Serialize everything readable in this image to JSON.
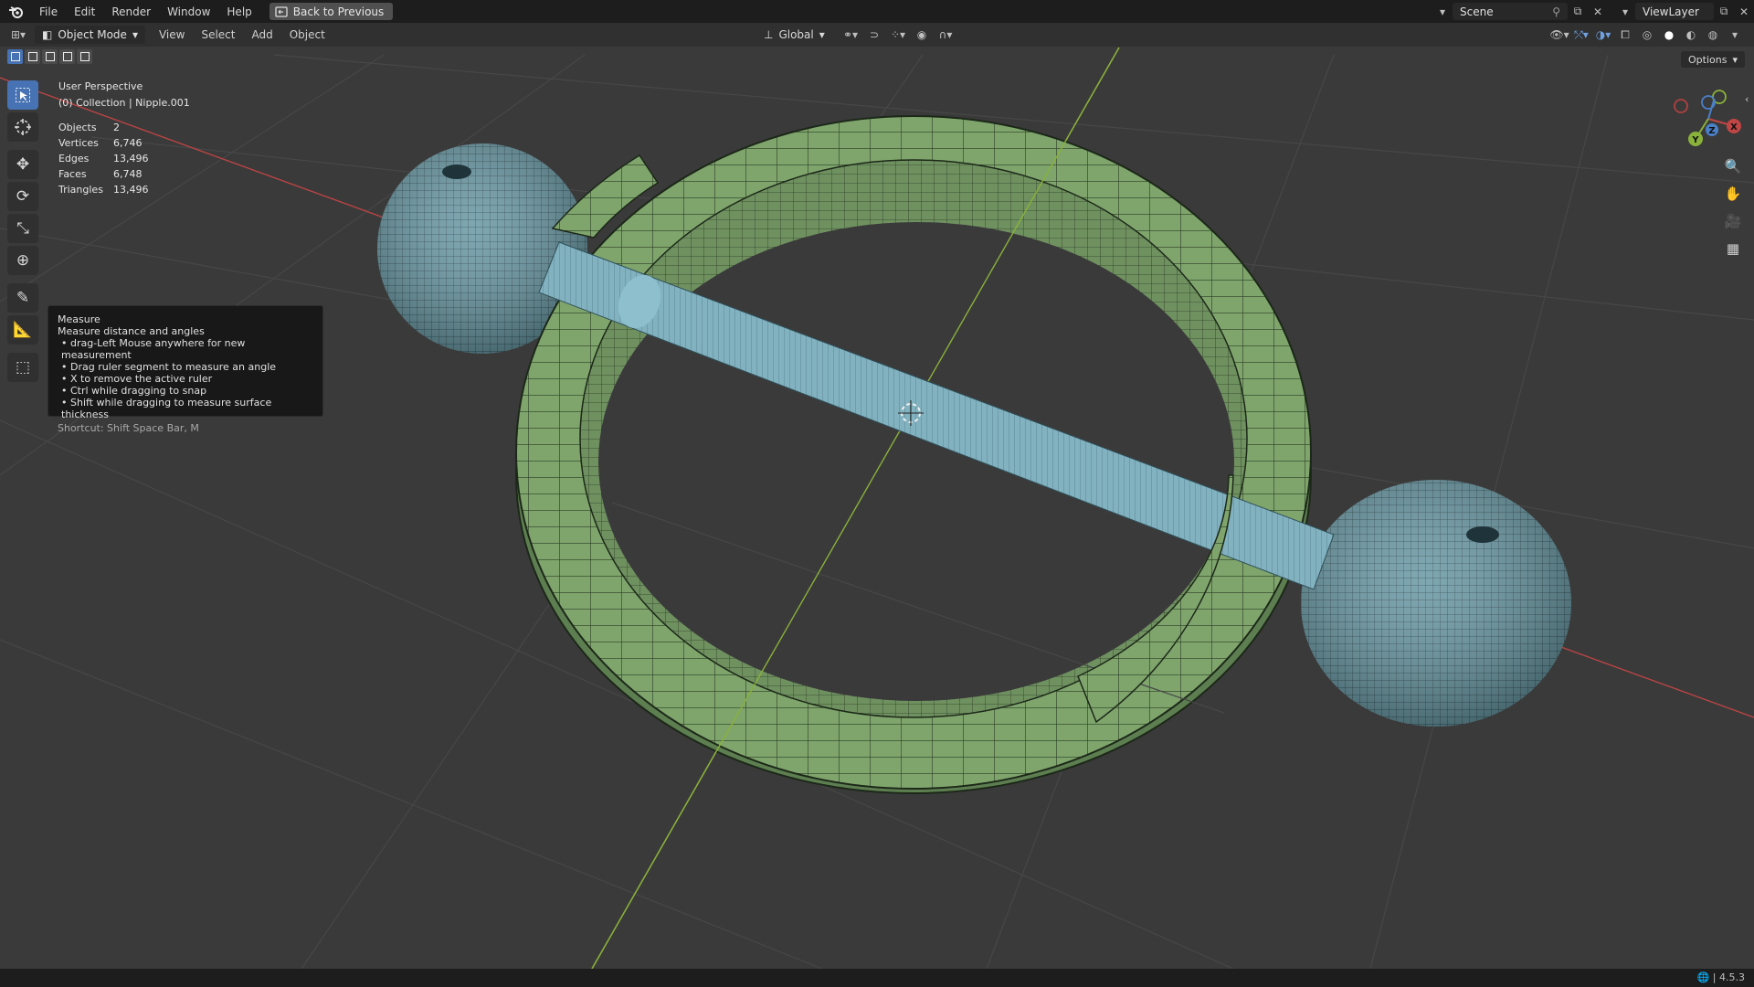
{
  "menu": {
    "items": [
      "File",
      "Edit",
      "Render",
      "Window",
      "Help"
    ],
    "back_button": "Back to Previous"
  },
  "topbar_right": {
    "scene": "Scene",
    "view_layer": "ViewLayer"
  },
  "viewport_header": {
    "mode": "Object Mode",
    "menus": [
      "View",
      "Select",
      "Add",
      "Object"
    ],
    "orientation": "Global",
    "options": "Options"
  },
  "viewport_info": {
    "perspective": "User Perspective",
    "collection": "(0) Collection | Nipple.001"
  },
  "stats": [
    {
      "label": "Objects",
      "value": "2"
    },
    {
      "label": "Vertices",
      "value": "6,746"
    },
    {
      "label": "Edges",
      "value": "13,496"
    },
    {
      "label": "Faces",
      "value": "6,748"
    },
    {
      "label": "Triangles",
      "value": "13,496"
    }
  ],
  "tooltip": {
    "title": "Measure",
    "description": "Measure distance and angles",
    "bullets": [
      "• drag-Left Mouse anywhere for new measurement",
      "• Drag ruler segment to measure an angle",
      "• X to remove the active ruler",
      "• Ctrl while dragging to snap",
      "• Shift while dragging to measure surface thickness"
    ],
    "shortcut": "Shortcut: Shift Space Bar, M"
  },
  "gizmo": {
    "x": "X",
    "y": "Y",
    "z": "Z"
  },
  "version": "4.5.3",
  "colors": {
    "ring": "#7fa46c",
    "ball": "#6a9aa6",
    "bar": "#7fb0bf",
    "axis_x": "#c04545",
    "axis_y": "#8ab13a"
  },
  "icons": {
    "logo": "blender-logo-icon",
    "tools": [
      "select-box-icon",
      "cursor-icon",
      "move-icon",
      "rotate-icon",
      "scale-icon",
      "transform-icon",
      "annotate-icon",
      "measure-icon",
      "add-cube-icon"
    ],
    "nav": [
      "zoom-icon",
      "pan-hand-icon",
      "camera-icon",
      "grid-icon"
    ]
  }
}
